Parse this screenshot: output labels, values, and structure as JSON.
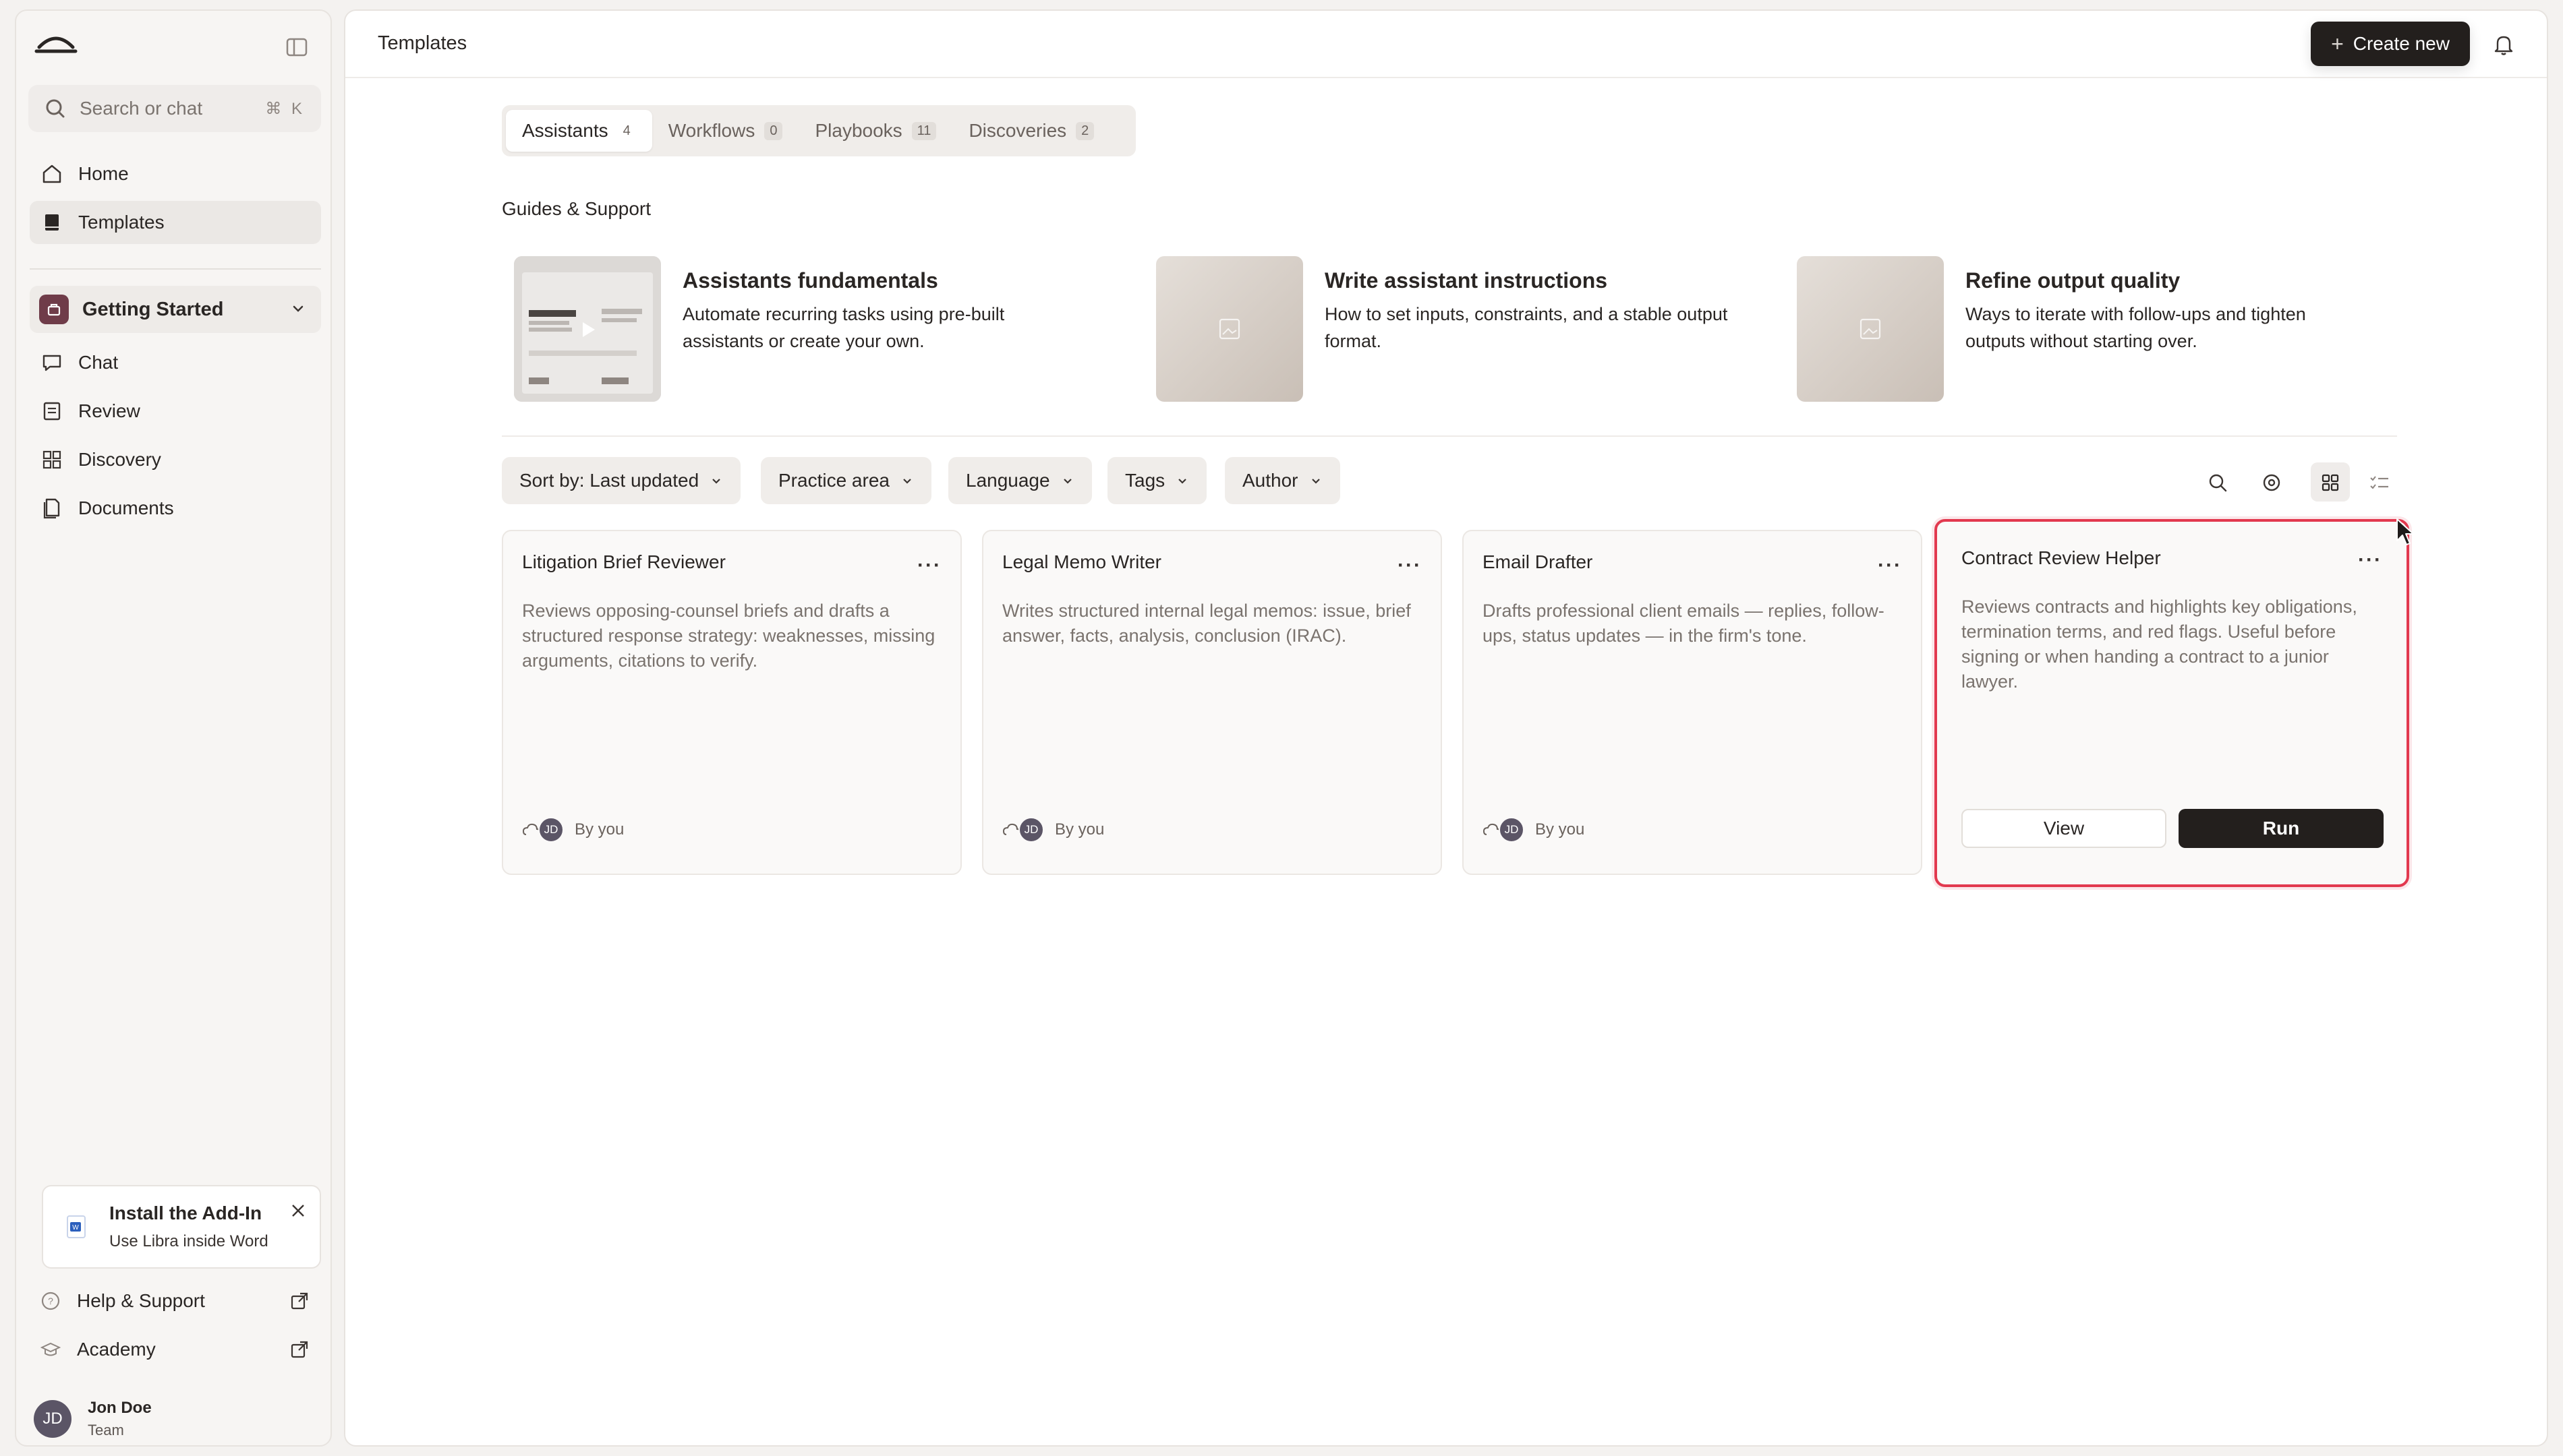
{
  "sidebar": {
    "search_placeholder": "Search or chat",
    "search_shortcut": "⌘ K",
    "nav": [
      {
        "label": "Home",
        "icon": "home-icon"
      },
      {
        "label": "Templates",
        "icon": "book-icon",
        "active": true
      }
    ],
    "workspace": {
      "label": "Getting Started",
      "color": "#6f3c49"
    },
    "workspace_nav": [
      {
        "label": "Chat",
        "icon": "chat-icon"
      },
      {
        "label": "Review",
        "icon": "review-icon"
      },
      {
        "label": "Discovery",
        "icon": "discovery-icon"
      },
      {
        "label": "Documents",
        "icon": "documents-icon"
      }
    ],
    "addin": {
      "title": "Install the Add-In",
      "subtitle": "Use Libra inside Word"
    },
    "footer": [
      {
        "label": "Help & Support",
        "icon": "help-icon"
      },
      {
        "label": "Academy",
        "icon": "academy-icon"
      }
    ],
    "user": {
      "initials": "JD",
      "name": "Jon Doe",
      "team": "Team"
    }
  },
  "header": {
    "title": "Templates",
    "create_label": "Create new"
  },
  "tabs": [
    {
      "label": "Assistants",
      "count": "4",
      "active": true
    },
    {
      "label": "Workflows",
      "count": "0"
    },
    {
      "label": "Playbooks",
      "count": "11"
    },
    {
      "label": "Discoveries",
      "count": "2"
    }
  ],
  "guides": {
    "section_label": "Guides & Support",
    "items": [
      {
        "title": "Assistants fundamentals",
        "desc": "Automate recurring tasks using pre-built assistants or create your own.",
        "has_video": true
      },
      {
        "title": "Write assistant instructions",
        "desc": "How to set inputs, constraints, and a stable output format."
      },
      {
        "title": "Refine output quality",
        "desc": "Ways to iterate with follow-ups and tighten outputs without starting over."
      }
    ]
  },
  "filters": {
    "sort": "Sort by: Last updated",
    "practice_area": "Practice area",
    "language": "Language",
    "tags": "Tags",
    "author": "Author"
  },
  "cards": [
    {
      "name": "Litigation Brief Reviewer",
      "desc": "Reviews opposing-counsel briefs and drafts a structured response strategy: weaknesses, missing arguments, citations to verify.",
      "initials": "JD",
      "author": "By you"
    },
    {
      "name": "Legal Memo Writer",
      "desc": "Writes structured internal legal memos: issue, brief answer, facts, analysis, conclusion (IRAC).",
      "initials": "JD",
      "author": "By you"
    },
    {
      "name": "Email Drafter",
      "desc": "Drafts professional client emails — replies, follow-ups, status updates — in the firm's tone.",
      "initials": "JD",
      "author": "By you"
    },
    {
      "name": "Contract Review Helper",
      "desc": "Reviews contracts and highlights key obligations, termination terms, and red flags. Useful before signing or when handing a contract to a junior lawyer.",
      "view_label": "View",
      "run_label": "Run",
      "highlighted": true
    }
  ],
  "colors": {
    "accent_dark": "#231f1d",
    "highlight": "#e2394f",
    "workspace": "#6f3c49"
  }
}
